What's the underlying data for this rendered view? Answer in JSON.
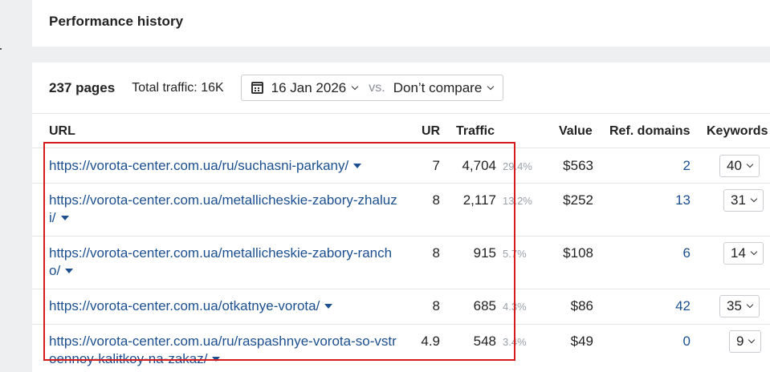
{
  "header": {
    "title": "Performance history"
  },
  "toolbar": {
    "pages": "237 pages",
    "total_traffic": "Total traffic: 16K",
    "date": "16 Jan 2026",
    "vs": "vs.",
    "compare": "Don’t compare"
  },
  "table": {
    "columns": {
      "url": "URL",
      "ur": "UR",
      "traffic": "Traffic",
      "value": "Value",
      "ref_domains": "Ref. domains",
      "keywords": "Keywords"
    },
    "rows": [
      {
        "url": "https://vorota-center.com.ua/ru/suchasni-parkany/",
        "ur": "7",
        "traffic": "4,704",
        "pct": "29.4%",
        "value": "$563",
        "ref_domains": "2",
        "keywords": "40"
      },
      {
        "url": "https://vorota-center.com.ua/metallicheskie-zabory-zhaluzi/",
        "ur": "8",
        "traffic": "2,117",
        "pct": "13.2%",
        "value": "$252",
        "ref_domains": "13",
        "keywords": "31"
      },
      {
        "url": "https://vorota-center.com.ua/metallicheskie-zabory-rancho/",
        "ur": "8",
        "traffic": "915",
        "pct": "5.7%",
        "value": "$108",
        "ref_domains": "6",
        "keywords": "14"
      },
      {
        "url": "https://vorota-center.com.ua/otkatnye-vorota/",
        "ur": "8",
        "traffic": "685",
        "pct": "4.3%",
        "value": "$86",
        "ref_domains": "42",
        "keywords": "35"
      },
      {
        "url": "https://vorota-center.com.ua/ru/raspashnye-vorota-so-vstroennoy-kalitkoy-na-zakaz/",
        "ur": "4.9",
        "traffic": "548",
        "pct": "3.4%",
        "value": "$49",
        "ref_domains": "0",
        "keywords": "9"
      }
    ]
  },
  "colors": {
    "link": "#1b4f8f",
    "highlight": "#d51b1b",
    "muted": "#9aa0a8"
  }
}
